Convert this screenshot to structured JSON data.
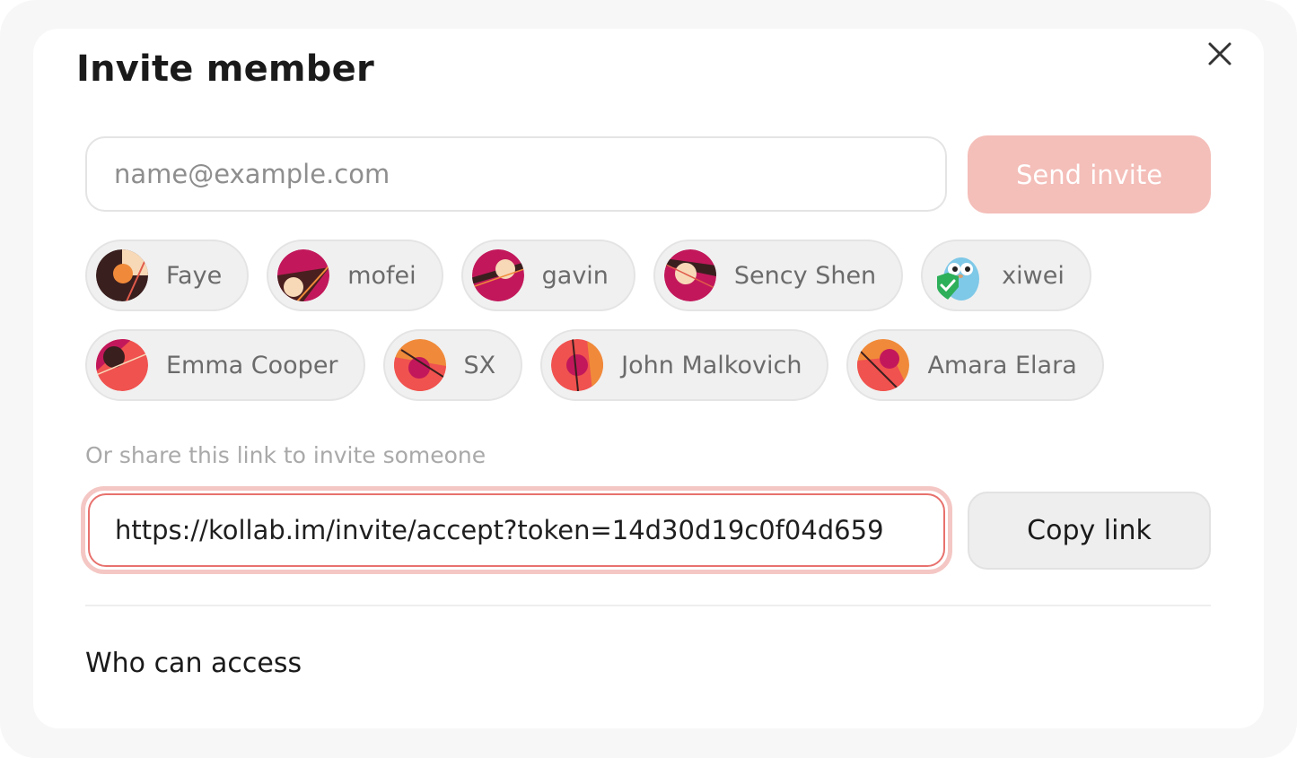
{
  "dialog": {
    "title": "Invite member",
    "close_icon": "close-icon"
  },
  "invite": {
    "email_placeholder": "name@example.com",
    "email_value": "",
    "send_label": "Send invite",
    "send_color": "#f4beb9"
  },
  "members": {
    "rows": [
      [
        {
          "name": "Faye",
          "avatar": "avatar-abstract"
        },
        {
          "name": "mofei",
          "avatar": "avatar-abstract"
        },
        {
          "name": "gavin",
          "avatar": "avatar-abstract"
        },
        {
          "name": "Sency Shen",
          "avatar": "avatar-abstract"
        },
        {
          "name": "xiwei",
          "avatar": "avatar-gopher"
        }
      ],
      [
        {
          "name": "Emma Cooper",
          "avatar": "avatar-abstract"
        },
        {
          "name": "SX",
          "avatar": "avatar-abstract"
        },
        {
          "name": "John Malkovich",
          "avatar": "avatar-abstract"
        },
        {
          "name": "Amara Elara",
          "avatar": "avatar-abstract"
        }
      ]
    ]
  },
  "share": {
    "hint": "Or share this link to invite someone",
    "link_value": "https://kollab.im/invite/accept?token=14d30d19c0f04d659",
    "copy_label": "Copy link",
    "focus_color": "#e8716d"
  },
  "access": {
    "title": "Who can access"
  }
}
